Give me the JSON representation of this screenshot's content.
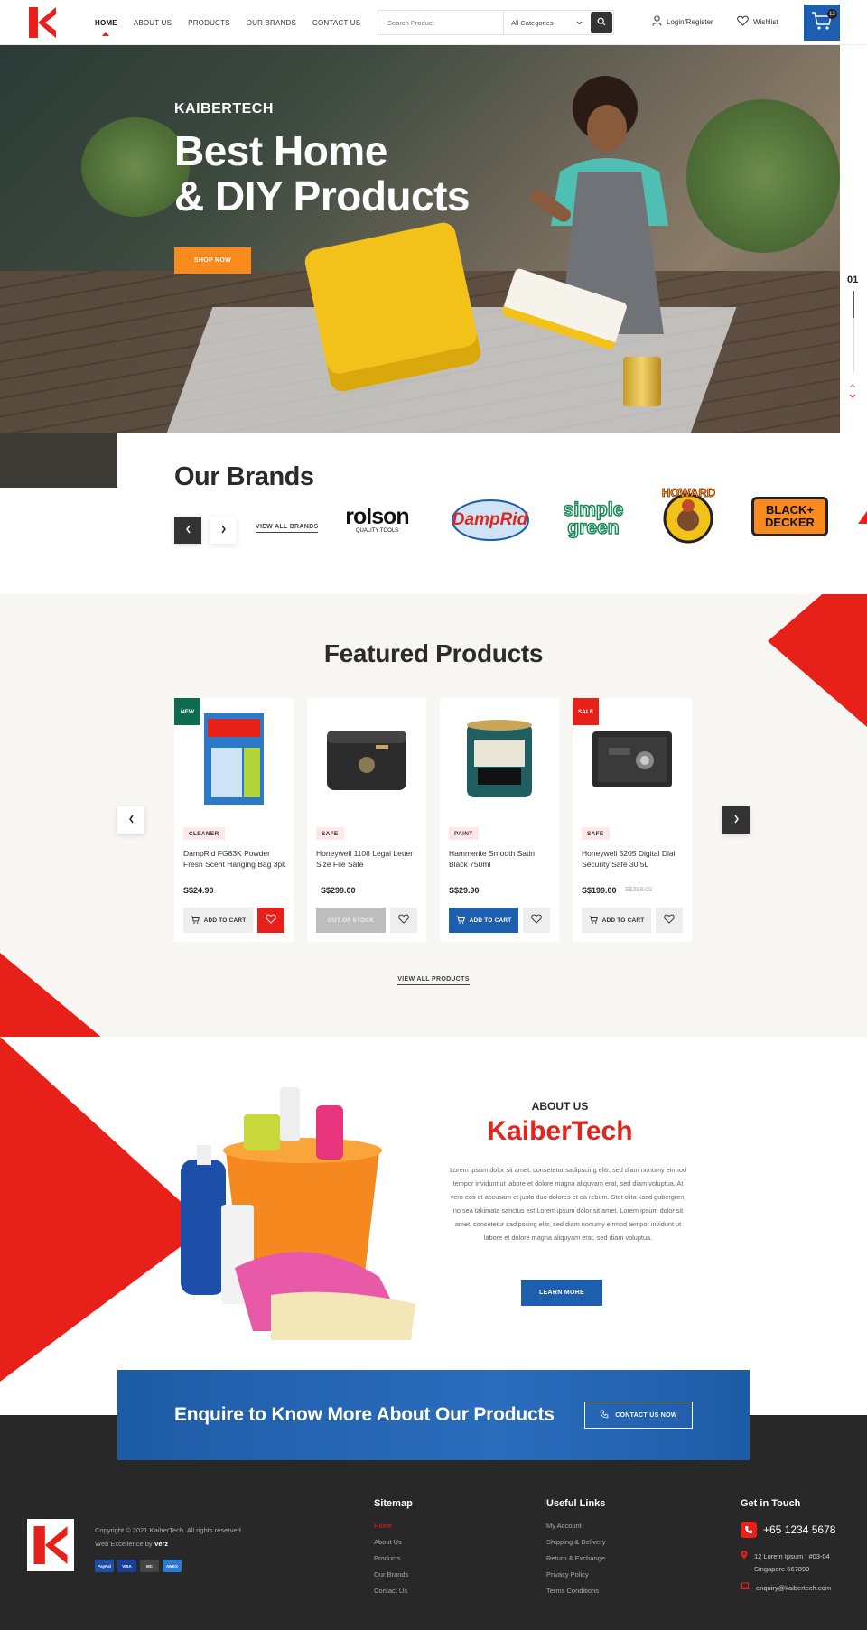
{
  "header": {
    "nav": [
      "HOME",
      "ABOUT US",
      "PRODUCTS",
      "OUR BRANDS",
      "CONTACT US"
    ],
    "search_placeholder": "Search Product",
    "category_select": "All Categories",
    "login_label": "Login/Register",
    "wishlist_label": "Wishlist",
    "cart_count": "12"
  },
  "hero": {
    "brand": "KAIBERTECH",
    "headline_line1": "Best Home",
    "headline_line2": "& DIY Products",
    "cta": "SHOP NOW",
    "slide_number": "01"
  },
  "brands": {
    "title": "Our Brands",
    "view_all": "VIEW ALL BRANDS",
    "logos": [
      {
        "name": "rolson",
        "sub": "QUALITY TOOLS"
      },
      {
        "name": "DampRid"
      },
      {
        "name": "simple green"
      },
      {
        "name": "HOWARD"
      },
      {
        "name": "BLACK+ DECKER"
      }
    ]
  },
  "featured": {
    "title": "Featured Products",
    "view_all": "VIEW ALL PRODUCTS",
    "products": [
      {
        "tag": "NEW",
        "category": "CLEANER",
        "name": "DampRid FG83K Powder Fresh Scent Hanging Bag 3pk",
        "price": "S$24.90",
        "old_price": "",
        "button": "ADD TO CART"
      },
      {
        "tag": "",
        "category": "SAFE",
        "name": "Honeywell 1108 Legal Letter Size File Safe",
        "price": "S$299.00",
        "old_price": "",
        "button": "OUT OF STOCK"
      },
      {
        "tag": "",
        "category": "PAINT",
        "name": "Hammerite Smooth Satin Black 750ml",
        "price": "S$29.90",
        "old_price": "",
        "button": "ADD TO CART"
      },
      {
        "tag": "SALE",
        "category": "SAFE",
        "name": "Honeywell 5205 Digital Dial Security Safe 30.5L",
        "price": "S$199.00",
        "old_price": "S$299.00",
        "button": "ADD TO CART"
      }
    ]
  },
  "about": {
    "label": "ABOUT US",
    "title": "KaiberTech",
    "description": "Lorem ipsum dolor sit amet, consetetur sadipscing elitr, sed diam nonumy eirmod tempor invidunt ut labore et dolore magna aliquyam erat, sed diam voluptua. At vero eos et accusam et justo duo dolores et ea rebum. Stet clita kasd gubergren, no sea takimata sanctus est Lorem ipsum dolor sit amet. Lorem ipsum dolor sit amet, consetetur sadipscing elitr, sed diam nonumy eirmod tempor invidunt ut labore et dolore magna aliquyam erat, sed diam voluptua.",
    "cta": "LEARN MORE"
  },
  "enquire": {
    "text": "Enquire to Know More About Our Products",
    "cta": "CONTACT US NOW"
  },
  "footer": {
    "copyright": "Copyright © 2021 KaiberTech. All rights reserved.",
    "credit_prefix": "Web Excellence by",
    "credit_name": "Verz",
    "payments": [
      "PayPal",
      "VISA",
      "MC",
      "AMEX"
    ],
    "sitemap_title": "Sitemap",
    "sitemap": [
      "Home",
      "About Us",
      "Products",
      "Our Brands",
      "Contact Us"
    ],
    "links_title": "Useful Links",
    "links": [
      "My Account",
      "Shipping & Delivery",
      "Return & Exchange",
      "Privacy Policy",
      "Terms Conditions"
    ],
    "contact_title": "Get in Touch",
    "phone": "+65 1234 5678",
    "address_line1": "12 Lorem Ipsum I #03-04",
    "address_line2": "Singapore 567890",
    "email": "enquiry@kaibertech.com"
  },
  "colors": {
    "brand_red": "#e8201a",
    "brand_blue": "#1d5fae",
    "orange": "#f98a1e",
    "tag_green": "#0d6b4e"
  }
}
